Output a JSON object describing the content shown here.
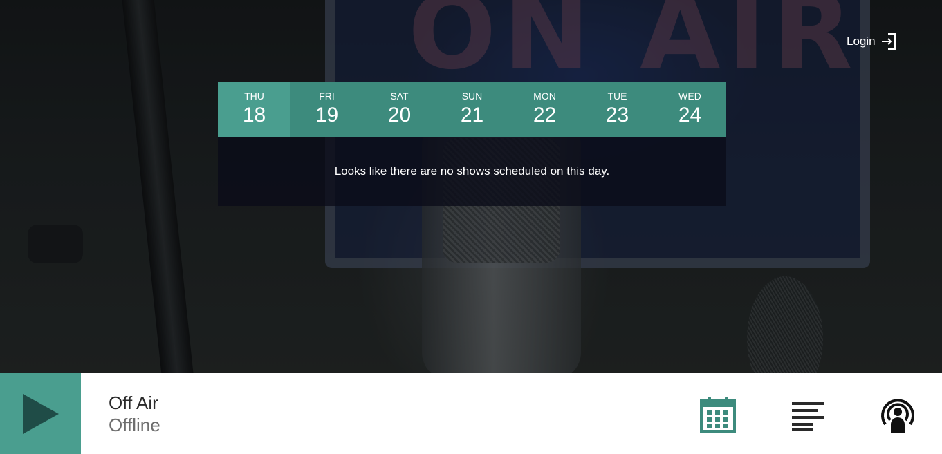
{
  "header": {
    "login_label": "Login"
  },
  "background": {
    "sign_text": "ON AIR"
  },
  "schedule": {
    "days": [
      {
        "name": "THU",
        "date": "18",
        "active": true
      },
      {
        "name": "FRI",
        "date": "19",
        "active": false
      },
      {
        "name": "SAT",
        "date": "20",
        "active": false
      },
      {
        "name": "SUN",
        "date": "21",
        "active": false
      },
      {
        "name": "MON",
        "date": "22",
        "active": false
      },
      {
        "name": "TUE",
        "date": "23",
        "active": false
      },
      {
        "name": "WED",
        "date": "24",
        "active": false
      }
    ],
    "empty_message": "Looks like there are no shows scheduled on this day."
  },
  "player": {
    "title": "Off Air",
    "status": "Offline",
    "play_icon": "play-icon",
    "icons": [
      "calendar-icon",
      "playlist-icon",
      "podcast-icon"
    ]
  },
  "colors": {
    "accent": "#3d8b7d",
    "accent_active": "#4a9e8f",
    "play_triangle": "#1f4c47"
  }
}
